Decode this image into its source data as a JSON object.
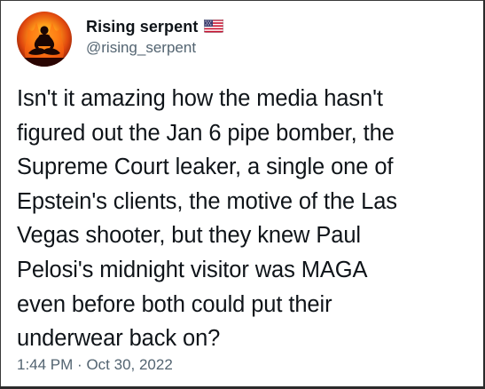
{
  "author": {
    "display_name": "Rising serpent",
    "handle": "@rising_serpent",
    "avatar_icon": "meditating-figure-fire-avatar",
    "flag_icon": "us-flag-icon"
  },
  "tweet": {
    "lines": [
      "Isn't it amazing how the media hasn't",
      "figured out the Jan 6 pipe bomber, the",
      "Supreme Court leaker, a single one of",
      "Epstein's clients, the motive of the Las",
      "Vegas shooter, but they knew Paul",
      "Pelosi's midnight visitor was MAGA",
      "even before both could put their",
      "underwear back on?"
    ],
    "time": "1:44 PM",
    "separator": "·",
    "date": "Oct 30, 2022"
  },
  "colors": {
    "text_primary": "#0f1419",
    "text_secondary": "#536471"
  }
}
